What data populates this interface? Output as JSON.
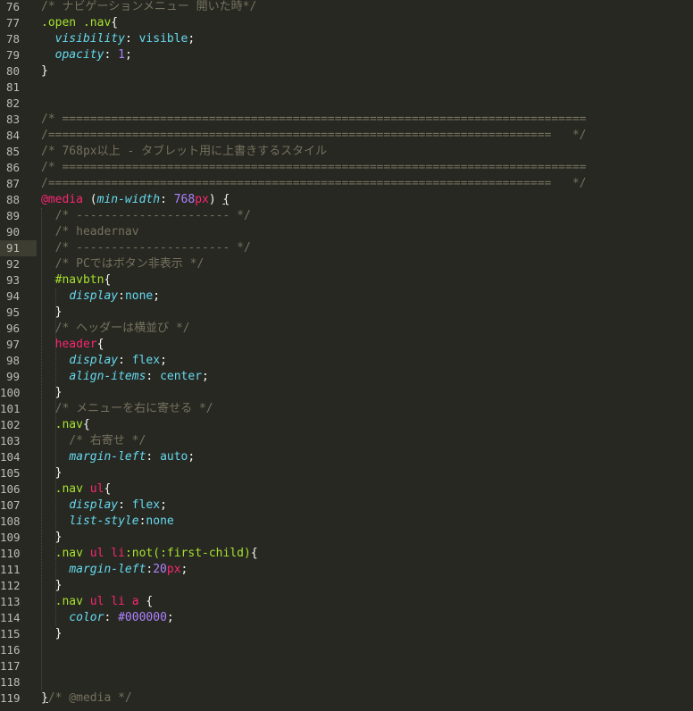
{
  "editor": {
    "lines": [
      {
        "num": "76",
        "tokens": [
          {
            "t": "/* ナビゲーションメニュー 開いた時*/",
            "c": "c"
          }
        ]
      },
      {
        "num": "77",
        "tokens": [
          {
            "t": ".open .nav",
            "c": "s"
          },
          {
            "t": "{",
            "c": "w"
          }
        ]
      },
      {
        "num": "78",
        "tokens": [
          {
            "t": "  ",
            "c": "w"
          },
          {
            "t": "visibility",
            "c": "p"
          },
          {
            "t": ": ",
            "c": "w"
          },
          {
            "t": "visible",
            "c": "v"
          },
          {
            "t": ";",
            "c": "w"
          }
        ]
      },
      {
        "num": "79",
        "tokens": [
          {
            "t": "  ",
            "c": "w"
          },
          {
            "t": "opacity",
            "c": "p"
          },
          {
            "t": ": ",
            "c": "w"
          },
          {
            "t": "1",
            "c": "n"
          },
          {
            "t": ";",
            "c": "w"
          }
        ]
      },
      {
        "num": "80",
        "tokens": [
          {
            "t": "}",
            "c": "w"
          }
        ]
      },
      {
        "num": "81",
        "tokens": []
      },
      {
        "num": "82",
        "tokens": []
      },
      {
        "num": "83",
        "tokens": [
          {
            "t": "/* ===========================================================================",
            "c": "c"
          }
        ]
      },
      {
        "num": "84",
        "tokens": [
          {
            "t": "/========================================================================   */",
            "c": "c"
          }
        ]
      },
      {
        "num": "85",
        "tokens": [
          {
            "t": "/* 768px以上 - タブレット用に上書きするスタイル",
            "c": "c"
          }
        ]
      },
      {
        "num": "86",
        "tokens": [
          {
            "t": "/* ===========================================================================",
            "c": "c"
          }
        ]
      },
      {
        "num": "87",
        "tokens": [
          {
            "t": "/========================================================================   */",
            "c": "c"
          }
        ]
      },
      {
        "num": "88",
        "tokens": [
          {
            "t": "@media",
            "c": "k"
          },
          {
            "t": " (",
            "c": "w"
          },
          {
            "t": "min-width",
            "c": "p"
          },
          {
            "t": ": ",
            "c": "w"
          },
          {
            "t": "768",
            "c": "n"
          },
          {
            "t": "px",
            "c": "u"
          },
          {
            "t": ") ",
            "c": "w"
          },
          {
            "t": "{",
            "c": "w",
            "ul": true
          }
        ]
      },
      {
        "num": "89",
        "tokens": [
          {
            "t": "  /* ---------------------- */",
            "c": "c"
          }
        ]
      },
      {
        "num": "90",
        "tokens": [
          {
            "t": "  /* headernav",
            "c": "c"
          }
        ]
      },
      {
        "num": "91",
        "tokens": [
          {
            "t": "  /* ---------------------- */",
            "c": "c"
          }
        ]
      },
      {
        "num": "92",
        "tokens": [
          {
            "t": "  /* PCではボタン非表示 */",
            "c": "c"
          }
        ]
      },
      {
        "num": "93",
        "tokens": [
          {
            "t": "  ",
            "c": "w"
          },
          {
            "t": "#navbtn",
            "c": "s"
          },
          {
            "t": "{",
            "c": "w"
          }
        ]
      },
      {
        "num": "94",
        "tokens": [
          {
            "t": "    ",
            "c": "w"
          },
          {
            "t": "display",
            "c": "p"
          },
          {
            "t": ":",
            "c": "w"
          },
          {
            "t": "none",
            "c": "v"
          },
          {
            "t": ";",
            "c": "w"
          }
        ]
      },
      {
        "num": "95",
        "tokens": [
          {
            "t": "  }",
            "c": "w"
          }
        ]
      },
      {
        "num": "96",
        "tokens": [
          {
            "t": "  /* ヘッダーは横並び */",
            "c": "c"
          }
        ]
      },
      {
        "num": "97",
        "tokens": [
          {
            "t": "  ",
            "c": "w"
          },
          {
            "t": "header",
            "c": "k"
          },
          {
            "t": "{",
            "c": "w"
          }
        ]
      },
      {
        "num": "98",
        "tokens": [
          {
            "t": "    ",
            "c": "w"
          },
          {
            "t": "display",
            "c": "p"
          },
          {
            "t": ": ",
            "c": "w"
          },
          {
            "t": "flex",
            "c": "v"
          },
          {
            "t": ";",
            "c": "w"
          }
        ]
      },
      {
        "num": "99",
        "tokens": [
          {
            "t": "    ",
            "c": "w"
          },
          {
            "t": "align-items",
            "c": "p"
          },
          {
            "t": ": ",
            "c": "w"
          },
          {
            "t": "center",
            "c": "v"
          },
          {
            "t": ";",
            "c": "w"
          }
        ]
      },
      {
        "num": "100",
        "tokens": [
          {
            "t": "  }",
            "c": "w"
          }
        ]
      },
      {
        "num": "101",
        "tokens": [
          {
            "t": "  /* メニューを右に寄せる */",
            "c": "c"
          }
        ]
      },
      {
        "num": "102",
        "tokens": [
          {
            "t": "  ",
            "c": "w"
          },
          {
            "t": ".nav",
            "c": "s"
          },
          {
            "t": "{",
            "c": "w"
          }
        ]
      },
      {
        "num": "103",
        "tokens": [
          {
            "t": "    /* 右寄せ */",
            "c": "c"
          }
        ]
      },
      {
        "num": "104",
        "tokens": [
          {
            "t": "    ",
            "c": "w"
          },
          {
            "t": "margin-left",
            "c": "p"
          },
          {
            "t": ": ",
            "c": "w"
          },
          {
            "t": "auto",
            "c": "v"
          },
          {
            "t": ";",
            "c": "w"
          }
        ]
      },
      {
        "num": "105",
        "tokens": [
          {
            "t": "  }",
            "c": "w"
          }
        ]
      },
      {
        "num": "106",
        "tokens": [
          {
            "t": "  ",
            "c": "w"
          },
          {
            "t": ".nav ",
            "c": "s"
          },
          {
            "t": "ul",
            "c": "k"
          },
          {
            "t": "{",
            "c": "w"
          }
        ]
      },
      {
        "num": "107",
        "tokens": [
          {
            "t": "    ",
            "c": "w"
          },
          {
            "t": "display",
            "c": "p"
          },
          {
            "t": ": ",
            "c": "w"
          },
          {
            "t": "flex",
            "c": "v"
          },
          {
            "t": ";",
            "c": "w"
          }
        ]
      },
      {
        "num": "108",
        "tokens": [
          {
            "t": "    ",
            "c": "w"
          },
          {
            "t": "list-style",
            "c": "p"
          },
          {
            "t": ":",
            "c": "w"
          },
          {
            "t": "none",
            "c": "v"
          }
        ]
      },
      {
        "num": "109",
        "tokens": [
          {
            "t": "  }",
            "c": "w"
          }
        ]
      },
      {
        "num": "110",
        "tokens": [
          {
            "t": "  ",
            "c": "w"
          },
          {
            "t": ".nav ",
            "c": "s"
          },
          {
            "t": "ul li",
            "c": "k"
          },
          {
            "t": ":not(:first-child)",
            "c": "s"
          },
          {
            "t": "{",
            "c": "w"
          }
        ]
      },
      {
        "num": "111",
        "tokens": [
          {
            "t": "    ",
            "c": "w"
          },
          {
            "t": "margin-left",
            "c": "p"
          },
          {
            "t": ":",
            "c": "w"
          },
          {
            "t": "20",
            "c": "n"
          },
          {
            "t": "px",
            "c": "u"
          },
          {
            "t": ";",
            "c": "w"
          }
        ]
      },
      {
        "num": "112",
        "tokens": [
          {
            "t": "  }",
            "c": "w"
          }
        ]
      },
      {
        "num": "113",
        "tokens": [
          {
            "t": "  ",
            "c": "w"
          },
          {
            "t": ".nav ",
            "c": "s"
          },
          {
            "t": "ul li a",
            "c": "k"
          },
          {
            "t": " {",
            "c": "w"
          }
        ]
      },
      {
        "num": "114",
        "tokens": [
          {
            "t": "    ",
            "c": "w"
          },
          {
            "t": "color",
            "c": "p"
          },
          {
            "t": ": ",
            "c": "w"
          },
          {
            "t": "#000000",
            "c": "n"
          },
          {
            "t": ";",
            "c": "w"
          }
        ]
      },
      {
        "num": "115",
        "tokens": [
          {
            "t": "  }",
            "c": "w"
          }
        ]
      },
      {
        "num": "116",
        "tokens": []
      },
      {
        "num": "117",
        "tokens": []
      },
      {
        "num": "118",
        "tokens": []
      },
      {
        "num": "119",
        "tokens": [
          {
            "t": "}",
            "c": "w",
            "ul": true
          },
          {
            "t": "/* @media */",
            "c": "c"
          }
        ]
      }
    ],
    "active_line": "91",
    "colors": {
      "background": "#272822",
      "comment": "#75715e",
      "selector": "#a6e22e",
      "keyword": "#f92672",
      "property": "#66d9ef",
      "number": "#ae81ff",
      "text": "#f8f8f2"
    }
  }
}
